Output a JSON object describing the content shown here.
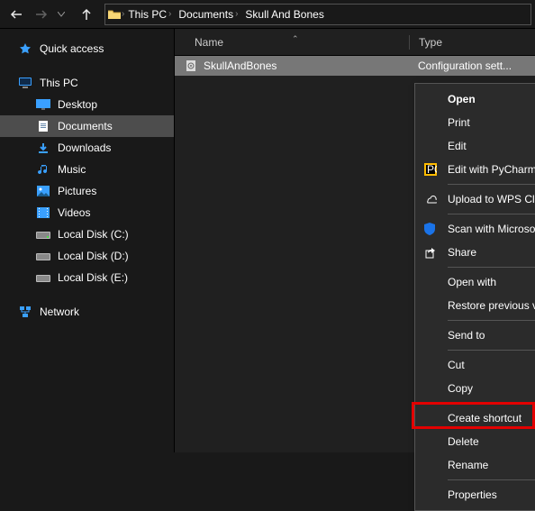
{
  "toolbar": {
    "breadcrumb": [
      "This PC",
      "Documents",
      "Skull And Bones"
    ]
  },
  "sidebar": {
    "quick_access": "Quick access",
    "this_pc": "This PC",
    "items": [
      "Desktop",
      "Documents",
      "Downloads",
      "Music",
      "Pictures",
      "Videos",
      "Local Disk (C:)",
      "Local Disk (D:)",
      "Local Disk (E:)"
    ],
    "network": "Network"
  },
  "columns": {
    "name": "Name",
    "type": "Type"
  },
  "row": {
    "name": "SkullAndBones",
    "type": "Configuration sett..."
  },
  "ctx": {
    "open": "Open",
    "print": "Print",
    "edit": "Edit",
    "pycharm": "Edit with PyCharm Community Edition",
    "wps": "Upload to WPS Cloud",
    "defender": "Scan with Microsoft Defender...",
    "share": "Share",
    "openwith": "Open with",
    "restore": "Restore previous versions",
    "sendto": "Send to",
    "cut": "Cut",
    "copy": "Copy",
    "shortcut": "Create shortcut",
    "delete": "Delete",
    "rename": "Rename",
    "properties": "Properties"
  }
}
